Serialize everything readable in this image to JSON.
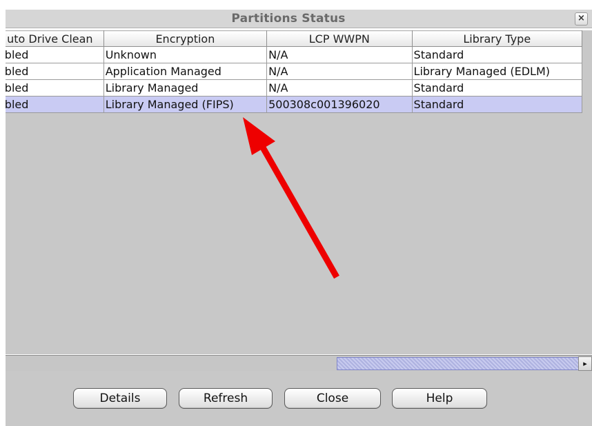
{
  "window": {
    "title": "Partitions Status",
    "close_glyph": "×"
  },
  "table": {
    "columns": [
      "uto Drive Clean",
      "Encryption",
      "LCP WWPN",
      "Library Type"
    ],
    "rows": [
      [
        "abled",
        "Unknown",
        "N/A",
        "Standard"
      ],
      [
        "abled",
        "Application Managed",
        "N/A",
        "Library Managed (EDLM)"
      ],
      [
        "abled",
        "Library Managed",
        "N/A",
        "Standard"
      ],
      [
        "abled",
        "Library Managed (FIPS)",
        "500308c001396020",
        "Standard"
      ]
    ],
    "selected_row_index": 3
  },
  "scrollbar": {
    "right_arrow": "▸"
  },
  "buttons": {
    "details": "Details",
    "refresh": "Refresh",
    "close": "Close",
    "help": "Help"
  },
  "colors": {
    "selected_row": "#c9cbf3",
    "annotation_arrow": "#ee0000"
  },
  "icons": {
    "close": "close-icon",
    "scroll_right": "chevron-right-icon",
    "annotation": "red-arrow-annotation"
  }
}
